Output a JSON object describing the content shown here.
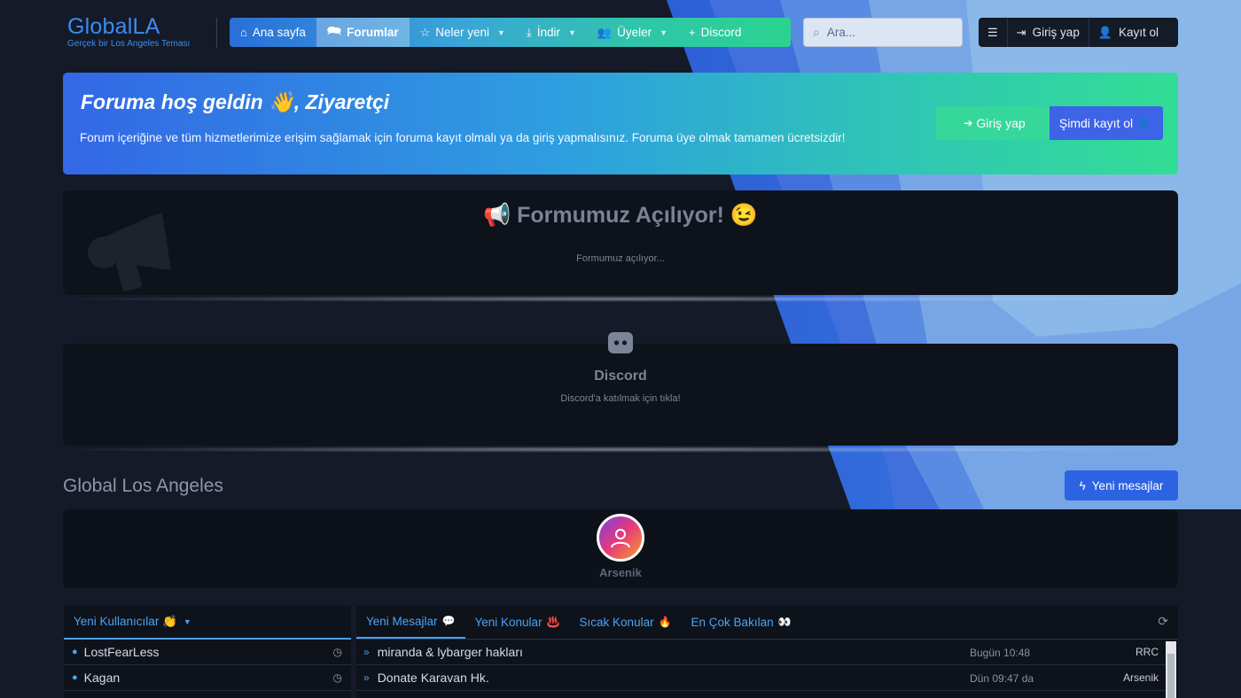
{
  "logo": {
    "title": "GlobalLA",
    "subtitle": "Gerçek bir Los Angeles Teması"
  },
  "nav": {
    "items": [
      {
        "label": "Ana sayfa",
        "icon": "home-icon",
        "has_dropdown": false,
        "active": false
      },
      {
        "label": "Forumlar",
        "icon": "forum-icon",
        "has_dropdown": false,
        "active": true
      },
      {
        "label": "Neler yeni",
        "icon": "star-icon",
        "has_dropdown": true,
        "active": false
      },
      {
        "label": "İndir",
        "icon": "download-icon",
        "has_dropdown": true,
        "active": false
      },
      {
        "label": "Üyeler",
        "icon": "users-icon",
        "has_dropdown": true,
        "active": false
      },
      {
        "label": "Discord",
        "icon": "plus-icon",
        "has_dropdown": false,
        "active": false
      }
    ]
  },
  "search": {
    "placeholder": "Ara..."
  },
  "user_nav": {
    "login": "Giriş yap",
    "register": "Kayıt ol"
  },
  "welcome": {
    "title": "Foruma hoş geldin 👋, Ziyaretçi",
    "text": "Forum içeriğine ve tüm hizmetlerimize erişim sağlamak için foruma kayıt olmalı ya da giriş yapmalısınız. Foruma üye olmak tamamen ücretsizdir!",
    "login_button": "Giriş yap",
    "register_button": "Şimdi kayıt ol"
  },
  "notice": {
    "title": "📢 Formumuz Açılıyor! 😉",
    "text": "Formumuz açılıyor..."
  },
  "discord": {
    "title": "Discord",
    "text": "Discord'a katılmak için tıkla!"
  },
  "section": {
    "title": "Global Los Angeles",
    "new_posts_button": "Yeni mesajlar"
  },
  "online": {
    "username": "Arsenik"
  },
  "new_users": {
    "header": "Yeni Kullanıcılar 👏",
    "users": [
      "LostFearLess",
      "Kagan"
    ]
  },
  "latest": {
    "tabs": [
      {
        "label": "Yeni Mesajlar",
        "emoji": "💬",
        "active": true
      },
      {
        "label": "Yeni Konular",
        "emoji": "♨️",
        "active": false
      },
      {
        "label": "Sıcak Konular",
        "emoji": "🔥",
        "active": false
      },
      {
        "label": "En Çok Bakılan",
        "emoji": "👀",
        "active": false
      }
    ],
    "threads": [
      {
        "title": "miranda & lybarger hakları",
        "time": "Bugün 10:48",
        "author": "RRC"
      },
      {
        "title": "Donate Karavan Hk.",
        "time": "Dün 09:47 da",
        "author": "Arsenik"
      }
    ]
  },
  "colors": {
    "background": "#141a27",
    "accent": "#4aa3f5",
    "primary_button": "#2c63e3",
    "success_button": "#36d79b"
  }
}
